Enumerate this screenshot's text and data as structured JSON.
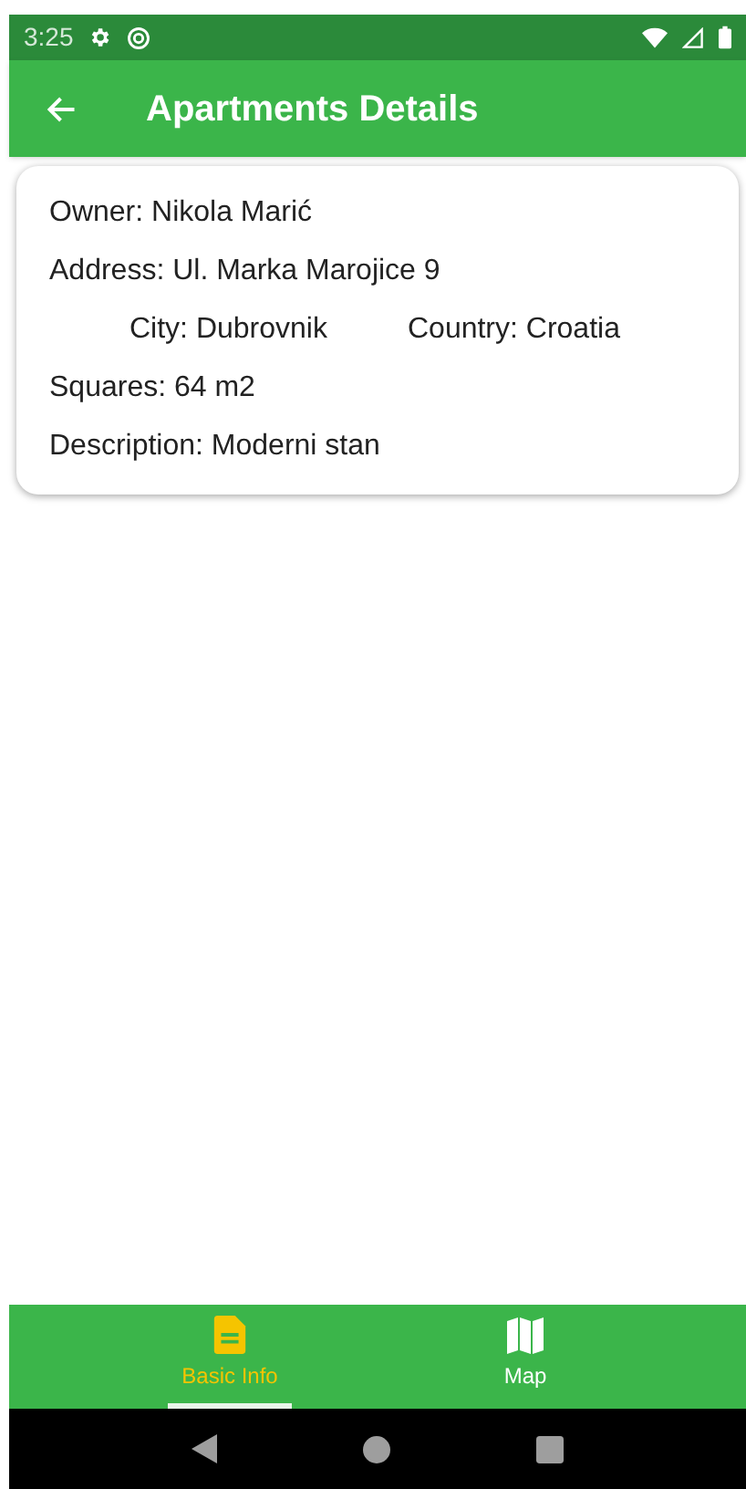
{
  "status_bar": {
    "time": "3:25"
  },
  "app_bar": {
    "title": "Apartments Details"
  },
  "details": {
    "owner": "Owner: Nikola Marić",
    "address": "Address: Ul. Marka Marojice 9",
    "city": "City: Dubrovnik",
    "country": "Country: Croatia",
    "squares": "Squares: 64 m2",
    "description": "Description: Moderni stan"
  },
  "bottom_nav": [
    {
      "label": "Basic Info",
      "kind": "document",
      "selected": true
    },
    {
      "label": "Map",
      "kind": "map",
      "selected": false
    }
  ]
}
